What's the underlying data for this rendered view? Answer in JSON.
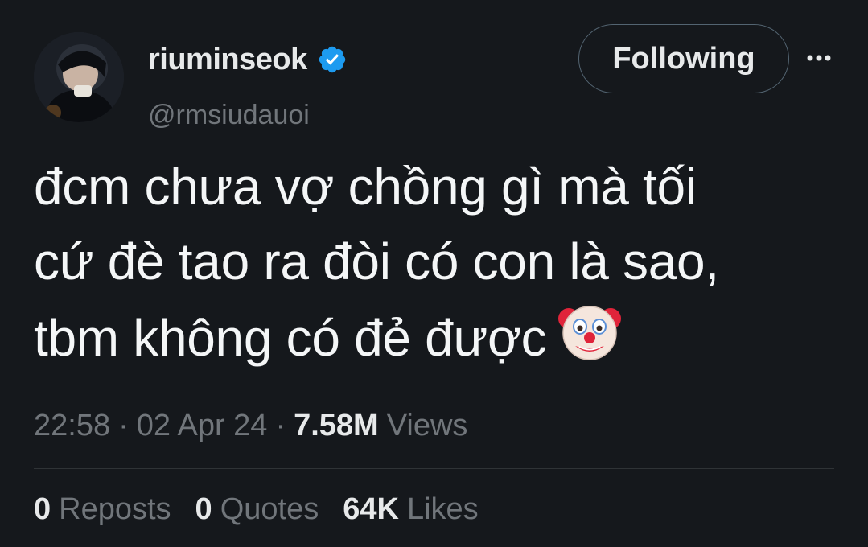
{
  "author": {
    "display_name": "riuminseok",
    "handle": "@rmsiudauoi",
    "verified_icon": "verified-badge-icon",
    "verified_color": "#1d9bf0"
  },
  "follow_button": {
    "label": "Following"
  },
  "more_icon": "more-options-icon",
  "tweet": {
    "line1": "đcm chưa vợ chồng gì mà tối",
    "line2": "cứ đè tao ra đòi có con là sao,",
    "line3": "tbm không có đẻ được",
    "emoji": "clown-face-icon"
  },
  "meta": {
    "time": "22:58",
    "sep1": "·",
    "date": "02 Apr 24",
    "sep2": "·",
    "views_count": "7.58M",
    "views_label": "Views"
  },
  "stats": {
    "reposts_count": "0",
    "reposts_label": "Reposts",
    "quotes_count": "0",
    "quotes_label": "Quotes",
    "likes_count": "64K",
    "likes_label": "Likes"
  },
  "colors": {
    "background": "#15181c",
    "text_primary": "#e7e9ea",
    "text_secondary": "#71767b",
    "divider": "#2f3336"
  }
}
